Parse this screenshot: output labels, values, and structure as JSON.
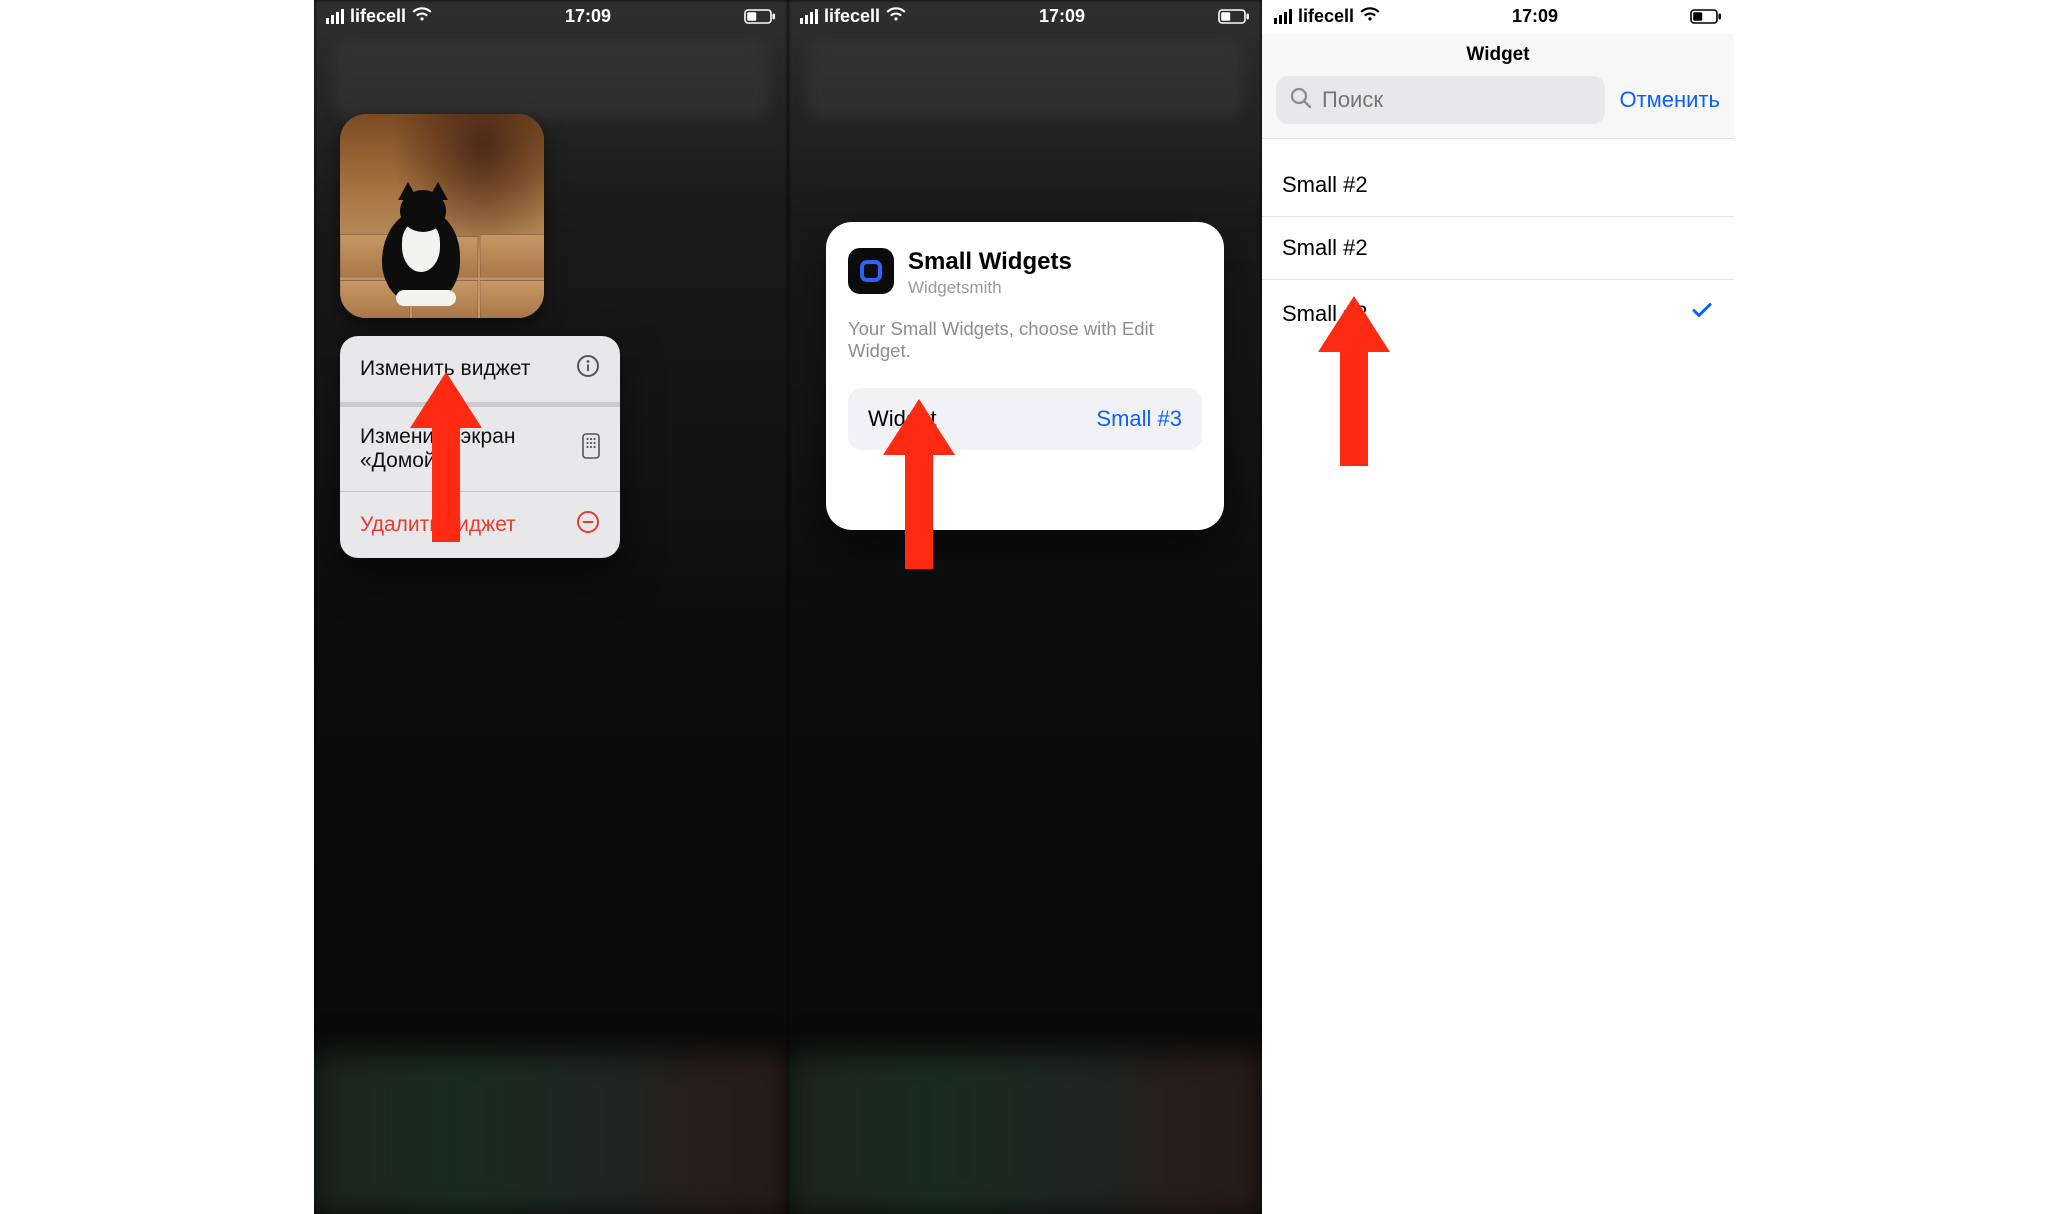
{
  "statusbar": {
    "carrier": "lifecell",
    "time": "17:09"
  },
  "screen1": {
    "menu": {
      "edit_widget": "Изменить виджет",
      "edit_home_line1": "Изменить экран",
      "edit_home_line2": "«Домой»",
      "delete_widget": "Удалить виджет"
    }
  },
  "screen2": {
    "card": {
      "title": "Small Widgets",
      "subtitle": "Widgetsmith",
      "description": "Your Small Widgets, choose with Edit Widget.",
      "row_label": "Widget",
      "row_value": "Small #3"
    }
  },
  "screen3": {
    "header_title": "Widget",
    "search_placeholder": "Поиск",
    "cancel": "Отменить",
    "options": [
      {
        "label": "Small #2",
        "selected": false
      },
      {
        "label": "Small #2",
        "selected": false
      },
      {
        "label": "Small #3",
        "selected": true
      }
    ]
  }
}
